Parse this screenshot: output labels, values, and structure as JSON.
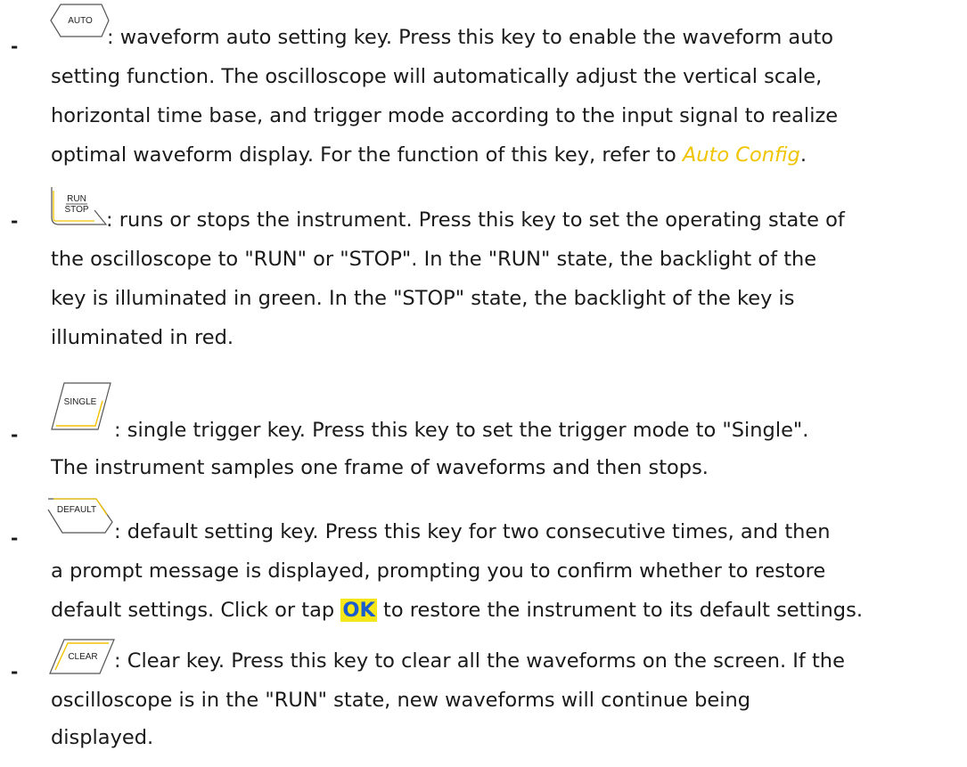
{
  "items": [
    {
      "key_label": "AUTO",
      "line1": ": waveform auto setting key. Press this key to enable the waveform auto",
      "line2": "setting function. The oscilloscope will automatically adjust the vertical scale,",
      "line3": "horizontal time base, and trigger mode according to the input signal to realize",
      "line4_pre": "optimal waveform display. For the function of this key, refer to ",
      "line4_link": "Auto Config",
      "line4_post": "."
    },
    {
      "key_label_top": "RUN",
      "key_label_bottom": "STOP",
      "line1": ": runs or stops the instrument. Press this key to set the operating state of",
      "line2": "the oscilloscope to \"RUN\" or \"STOP\". In the \"RUN\" state, the backlight of the",
      "line3": "key is illuminated in green. In the \"STOP\" state, the backlight of the key is",
      "line4": "illuminated in red."
    },
    {
      "key_label": "SINGLE",
      "line1": ": single trigger key. Press this key to set the trigger mode to \"Single\".",
      "line2": "The instrument samples one frame of waveforms and then stops."
    },
    {
      "key_label": "DEFAULT",
      "line1": ": default setting key. Press this key for two consecutive times, and then",
      "line2": "a prompt message is displayed, prompting you to confirm whether to restore",
      "line3_pre": "default settings. Click or tap ",
      "line3_ok": "OK",
      "line3_post": " to restore the instrument to its default settings."
    },
    {
      "key_label": "CLEAR",
      "line1": ": Clear key. Press this key to clear all the waveforms on the screen. If the",
      "line2": "oscilloscope is in the \"RUN\" state, new waveforms will continue being",
      "line3": "displayed."
    }
  ],
  "bullet": "-",
  "colors": {
    "link": "#f0c400",
    "ok_highlight": "#f5e61a",
    "ok_text": "#1b5ccc",
    "key_accent": "#f2c300"
  }
}
